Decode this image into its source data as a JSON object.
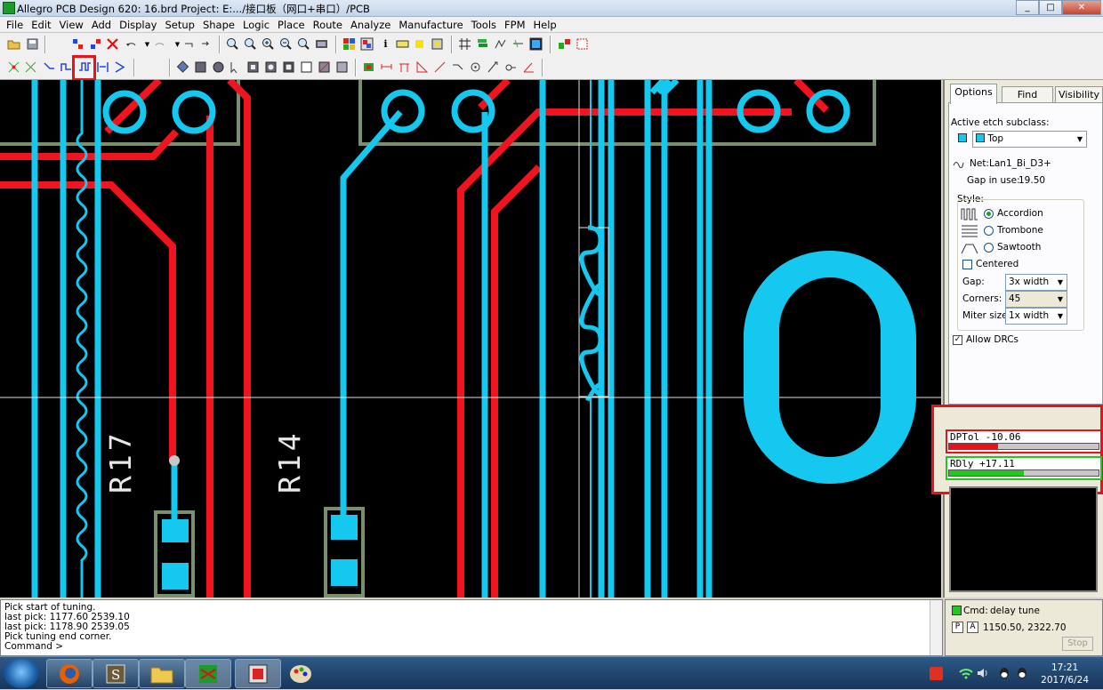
{
  "window": {
    "title": "Allegro PCB Design 620: 16.brd  Project: E:.../接口板（网口+串口）/PCB",
    "min": "_",
    "max": "□",
    "close": "✕"
  },
  "menu": [
    "File",
    "Edit",
    "View",
    "Add",
    "Display",
    "Setup",
    "Shape",
    "Logic",
    "Place",
    "Route",
    "Analyze",
    "Manufacture",
    "Tools",
    "FPM",
    "Help"
  ],
  "canvas": {
    "ref_r17": "R17",
    "ref_r14": "R14",
    "colors": {
      "trace_cyan": "#14c8f0",
      "trace_red": "#f0141e",
      "outline": "#7a8f6e",
      "background": "#000000"
    }
  },
  "panel": {
    "tabs": [
      "Options",
      "Find",
      "Visibility"
    ],
    "active_etch_label": "Active etch subclass:",
    "subclass": "Top",
    "net_label": "Net:",
    "net": "Lan1_Bi_D3+",
    "gap_in_use_label": "Gap in use:",
    "gap_in_use": "19.50",
    "style_label": "Style:",
    "styles": [
      "Accordion",
      "Trombone",
      "Sawtooth"
    ],
    "selected_style": "Accordion",
    "centered_label": "Centered",
    "gap_label": "Gap:",
    "gap_value": "3x width",
    "corners_label": "Corners:",
    "corners_value": "45",
    "miter_label": "Miter size:",
    "miter_value": "1x width",
    "allow_drcs_label": "Allow DRCs"
  },
  "meters": [
    {
      "text": "DPTol -10.06",
      "border": "#e8131a",
      "fill_color": "#e8131a",
      "fill": 0.33
    },
    {
      "text": "RDly +17.11",
      "border": "#22c722",
      "fill_color": "#22c722",
      "fill": 0.5
    }
  ],
  "console": {
    "lines": [
      "Pick start of tuning.",
      "last pick:  1177.60  2539.10",
      "last pick:  1178.90  2539.05",
      "Pick tuning end corner.",
      "Command >"
    ]
  },
  "status": {
    "cmd_label": "Cmd:",
    "cmd": "delay tune",
    "p_label": "P",
    "a_label": "A",
    "coords": "1150.50, 2322.70",
    "stop": "Stop"
  },
  "taskbar": {
    "time": "17:21",
    "date": "2017/6/24"
  }
}
